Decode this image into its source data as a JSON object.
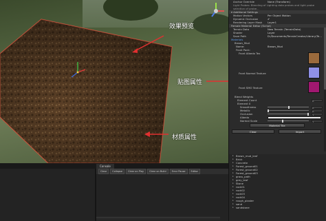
{
  "annotations": {
    "preview_label": "效果预览",
    "texture_label": "贴图属性",
    "material_label": "材质属性"
  },
  "console": {
    "tab_label": "Console",
    "buttons": [
      "Clear",
      "Collapse",
      "Clear on Play",
      "Clear on Build",
      "Error Pause",
      "Editor"
    ]
  },
  "inspector": {
    "top_rows": [
      {
        "label": "Anchor Override",
        "value": "None (Transform)"
      },
      {
        "label": "",
        "value": "Light Probes: Blending of Lighting data probes and light probe"
      },
      {
        "label": "",
        "value": "selection of probe..."
      },
      {
        "label": "▾ Additional Settings",
        "value": ""
      },
      {
        "label": "Motion Vectors",
        "value": "Per Object Motion"
      },
      {
        "label": "Dynamic Occlusion",
        "value": "✔"
      },
      {
        "label": "Rendering Layer Mask",
        "value": "Layer1"
      }
    ],
    "script_row": {
      "label": "Female Material Editor (Script)",
      "value": ""
    },
    "fields": [
      {
        "label": "Terrain Data",
        "value": "New Terrain (TerrainData)"
      },
      {
        "label": "Shader",
        "value": "Layer"
      },
      {
        "label": "Save Path",
        "value": "D:/Documents/TerrainCreator/Library/Te..."
      }
    ],
    "section_title": "Materials",
    "material_name": "Brown_Mud",
    "name_label": "Name:",
    "name_value": "Brown_Mud",
    "front_pack_label": "Front Pack:",
    "textures": [
      {
        "label": "Front Albedo Tex",
        "color": "#9a6a3c"
      },
      {
        "label": "Front Normal Texture",
        "color": "#8f90e6"
      },
      {
        "label": "Front SMO Texture",
        "color": "#a01870"
      }
    ],
    "blend_title": "Blend Weights",
    "element_count_label": "Element Count",
    "element_count": "0",
    "element_label": "Element 0",
    "sliders": [
      {
        "label": "Smoothness",
        "value": 0.5,
        "num": "0"
      },
      {
        "label": "Metallic",
        "value": 0.0,
        "num": "0"
      },
      {
        "label": "Occlusion",
        "value": 1.0,
        "num": "1"
      },
      {
        "label": "Albedo",
        "value": 1.0,
        "num": ""
      },
      {
        "label": "Normal Scale",
        "value": 0.35,
        "num": "1"
      }
    ],
    "material_tile_button": "Material Tile",
    "clear_button": "Clear",
    "import_button": "Import",
    "list_items": [
      "Brown_mud_leaf",
      "Brick",
      "Concrete",
      "Forest_ground01",
      "Forest_ground02",
      "Forest_ground03",
      "grass_path",
      "grey_leaf",
      "Stone",
      "rock01",
      "rock02",
      "rock03",
      "rock04",
      "rough_plaster",
      "sand",
      "sandstone"
    ]
  }
}
